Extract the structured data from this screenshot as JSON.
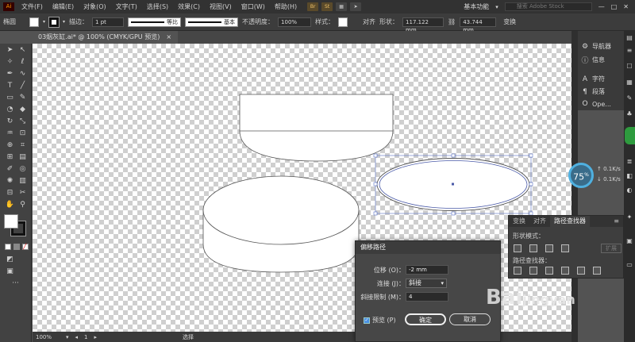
{
  "menubar": {
    "logo": "Ai",
    "items": [
      "文件(F)",
      "编辑(E)",
      "对象(O)",
      "文字(T)",
      "选择(S)",
      "效果(C)",
      "视图(V)",
      "窗口(W)",
      "帮助(H)"
    ],
    "apps": [
      "Br",
      "St"
    ],
    "workspace": "基本功能",
    "stock_placeholder": "搜索 Adobe Stock"
  },
  "controlbar": {
    "selection": "椭圆",
    "stroke_label": "描边：",
    "stroke_weight": "1 pt",
    "profile_label": "等比",
    "brush_label": "基本",
    "opacity_label": "不透明度：",
    "opacity_value": "100%",
    "style_label": "样式：",
    "align_label": "对齐",
    "shape_label": "形状：",
    "width_value": "117.122 mm",
    "height_value": "43.744 mm",
    "transform_label": "变换"
  },
  "document_tab": {
    "title": "03烟灰缸.ai* @ 100% (CMYK/GPU 预览)",
    "close": "×"
  },
  "dock": {
    "items": [
      {
        "label": "导航器",
        "icon": "navigator-icon"
      },
      {
        "label": "信息",
        "icon": "info-icon"
      },
      {
        "label": "字符",
        "icon": "character-icon"
      },
      {
        "label": "段落",
        "icon": "paragraph-icon"
      },
      {
        "label": "Ope...",
        "icon": "opentype-icon"
      }
    ]
  },
  "speed_widget": {
    "percent": "75",
    "unit": "%",
    "up": "0.1K/s",
    "down": "0.1K/s"
  },
  "pathfinder": {
    "tabs": [
      "变换",
      "对齐",
      "路径查找器"
    ],
    "active_tab": "路径查找器",
    "shape_modes_label": "形状模式：",
    "pathfinders_label": "路径查找器：",
    "expand_label": "扩展"
  },
  "offset_dialog": {
    "title": "偏移路径",
    "offset_label": "位移 (O)：",
    "offset_value": "-2 mm",
    "joins_label": "连接 (J)：",
    "joins_value": "斜接",
    "miter_label": "斜接限制 (M)：",
    "miter_value": "4",
    "preview_label": "预览 (P)",
    "preview_checked": true,
    "ok_label": "确定",
    "cancel_label": "取消"
  },
  "statusbar": {
    "zoom": "100%",
    "page": "1",
    "tool": "选择"
  },
  "watermark": {
    "text": "Bai",
    "sub": "jingyan"
  },
  "colors": {
    "menubar": "#323232",
    "panel": "#424242",
    "selection_blue": "#4a5aa8",
    "accent_green": "#2e9b3e",
    "speed_blue": "#4fb0e0"
  }
}
